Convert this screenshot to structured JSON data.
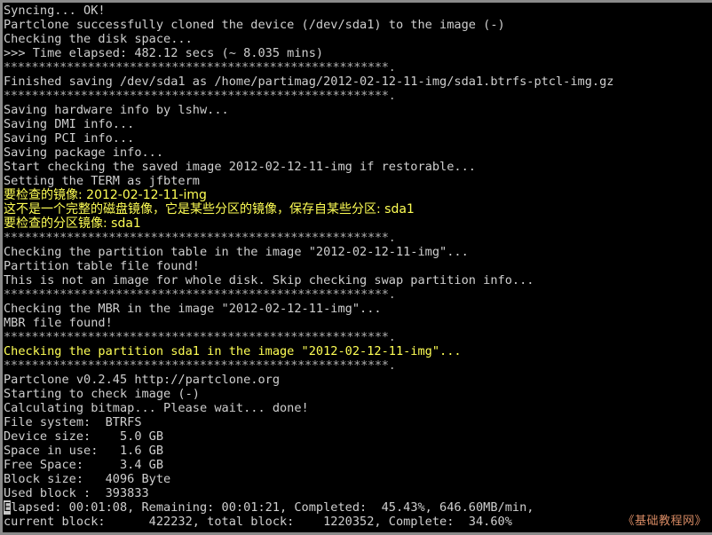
{
  "window": {
    "kind": "terminal",
    "background_color": "#000000",
    "frame_color": "#8a8a8a",
    "default_text_color": "#c8c8c8",
    "highlight_text_color": "#ffff55",
    "watermark_color": "#d78a63"
  },
  "terminal": {
    "lines": [
      {
        "text": "Syncing... OK!",
        "color": "white"
      },
      {
        "text": "Partclone successfully cloned the device (/dev/sda1) to the image (-)",
        "color": "white"
      },
      {
        "text": "Checking the disk space...",
        "color": "white"
      },
      {
        "text": ">>> Time elapsed: 482.12 secs (~ 8.035 mins)",
        "color": "white"
      },
      {
        "text": "*******************************************************.",
        "color": "stars"
      },
      {
        "text": "Finished saving /dev/sda1 as /home/partimag/2012-02-12-11-img/sda1.btrfs-ptcl-img.gz",
        "color": "white"
      },
      {
        "text": "*******************************************************.",
        "color": "stars"
      },
      {
        "text": "Saving hardware info by lshw...",
        "color": "white"
      },
      {
        "text": "Saving DMI info...",
        "color": "white"
      },
      {
        "text": "Saving PCI info...",
        "color": "white"
      },
      {
        "text": "Saving package info...",
        "color": "white"
      },
      {
        "text": "Start checking the saved image 2012-02-12-11-img if restorable...",
        "color": "white"
      },
      {
        "text": "Setting the TERM as jfbterm",
        "color": "white"
      },
      {
        "text": "要检查的镜像: 2012-02-12-11-img",
        "color": "yellow",
        "cjk": true
      },
      {
        "text": "这不是一个完整的磁盘镜像，它是某些分区的镜像，保存自某些分区: sda1",
        "color": "yellow",
        "cjk": true
      },
      {
        "text": "要检查的分区镜像: sda1",
        "color": "yellow",
        "cjk": true
      },
      {
        "text": "*******************************************************.",
        "color": "stars"
      },
      {
        "text": "Checking the partition table in the image \"2012-02-12-11-img\"...",
        "color": "white"
      },
      {
        "text": "Partition table file found!",
        "color": "white"
      },
      {
        "text": "This is not an image for whole disk. Skip checking swap partition info...",
        "color": "white"
      },
      {
        "text": "*******************************************************.",
        "color": "stars"
      },
      {
        "text": "Checking the MBR in the image \"2012-02-12-11-img\"...",
        "color": "white"
      },
      {
        "text": "MBR file found!",
        "color": "white"
      },
      {
        "text": "*******************************************************.",
        "color": "stars"
      },
      {
        "text": "Checking the partition sda1 in the image \"2012-02-12-11-img\"...",
        "color": "yellow"
      },
      {
        "text": "*******************************************************.",
        "color": "stars"
      },
      {
        "text": "Partclone v0.2.45 http://partclone.org",
        "color": "white"
      },
      {
        "text": "Starting to check image (-)",
        "color": "white"
      },
      {
        "text": "Calculating bitmap... Please wait... done!",
        "color": "white"
      },
      {
        "text": "File system:  BTRFS",
        "color": "white"
      },
      {
        "text": "Device size:    5.0 GB",
        "color": "white"
      },
      {
        "text": "Space in use:   1.6 GB",
        "color": "white"
      },
      {
        "text": "Free Space:     3.4 GB",
        "color": "white"
      },
      {
        "text": "Block size:   4096 Byte",
        "color": "white"
      },
      {
        "text": "Used block :  393833",
        "color": "white"
      },
      {
        "text": "Elapsed: 00:01:08, Remaining: 00:01:21, Completed:  45.43%, 646.60MB/min,",
        "color": "white",
        "cursor_at": 0
      },
      {
        "text": "current block:      422232, total block:    1220352, Complete:  34.60%",
        "color": "white"
      }
    ]
  },
  "partclone_status": {
    "version_line": "Partclone v0.2.45 http://partclone.org",
    "file_system": "BTRFS",
    "device_size": "5.0 GB",
    "space_in_use": "1.6 GB",
    "free_space": "3.4 GB",
    "block_size": "4096 Byte",
    "used_block": "393833",
    "elapsed": "00:01:08",
    "remaining": "00:01:21",
    "completed_percent": "45.43%",
    "rate": "646.60MB/min",
    "current_block": "422232",
    "total_block": "1220352",
    "complete_percent": "34.60%"
  },
  "image": {
    "name": "2012-02-12-11-img",
    "source_device": "/dev/sda1",
    "saved_path": "/home/partimag/2012-02-12-11-img/sda1.btrfs-ptcl-img.gz",
    "partition": "sda1",
    "time_elapsed_secs": "482.12",
    "time_elapsed_mins": "8.035"
  },
  "watermark": {
    "text": "《基础教程网》"
  }
}
